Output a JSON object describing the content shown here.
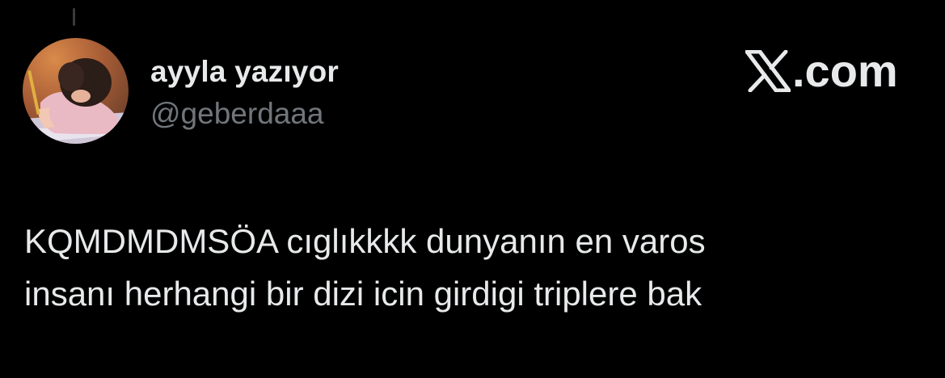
{
  "author": {
    "display_name": "ayyla yazıyor",
    "handle": "@geberdaaa",
    "avatar_icon": "profile-photo"
  },
  "brand": {
    "logo_icon": "x-logo-icon",
    "domain_text": ".com"
  },
  "tweet": {
    "lines": [
      "KQMDMDMSÖA cıglıkkkk dunyanın en varos",
      "insanı herhangi bir dizi icin girdigi triplere bak"
    ]
  },
  "colors": {
    "background": "#000000",
    "primary_text": "#e7e9ea",
    "secondary_text": "#71767b"
  }
}
